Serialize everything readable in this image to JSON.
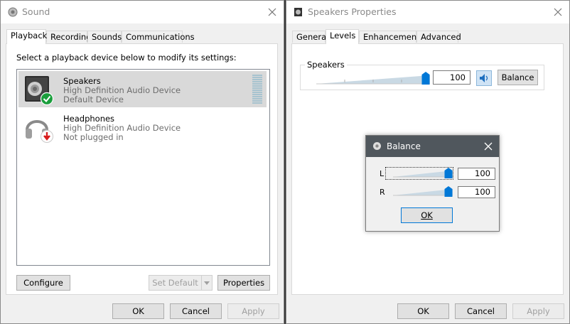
{
  "sound": {
    "title": "Sound",
    "tabs": [
      "Playback",
      "Recording",
      "Sounds",
      "Communications"
    ],
    "instruction": "Select a playback device below to modify its settings:",
    "devices": [
      {
        "name": "Speakers",
        "line1": "High Definition Audio Device",
        "line2": "Default Device",
        "status_icon": "check-icon"
      },
      {
        "name": "Headphones",
        "line1": "High Definition Audio Device",
        "line2": "Not plugged in",
        "status_icon": "down-arrow-icon"
      }
    ],
    "buttons": {
      "configure": "Configure",
      "set_default": "Set Default",
      "properties": "Properties"
    },
    "footer": {
      "ok": "OK",
      "cancel": "Cancel",
      "apply": "Apply"
    }
  },
  "props": {
    "title": "Speakers Properties",
    "tabs": [
      "General",
      "Levels",
      "Enhancements",
      "Advanced"
    ],
    "group_label": "Speakers",
    "volume": "100",
    "volume_level": 1.0,
    "balance_button": "Balance",
    "footer": {
      "ok": "OK",
      "cancel": "Cancel",
      "apply": "Apply"
    }
  },
  "balance": {
    "title": "Balance",
    "left_label": "L",
    "left_value": "100",
    "left_level": 1.0,
    "right_label": "R",
    "right_value": "100",
    "right_level": 1.0,
    "ok": "OK"
  },
  "colors": {
    "accent": "#0078d7",
    "check_green": "#1a9e3c",
    "unplugged_red": "#d81e1e"
  }
}
